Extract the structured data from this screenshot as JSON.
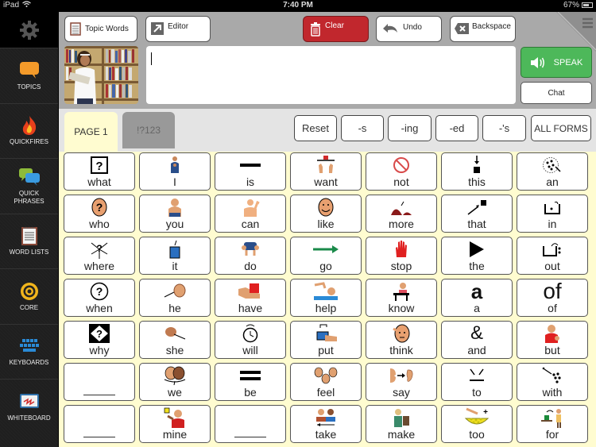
{
  "status_bar": {
    "device": "iPad",
    "time": "7:40 PM",
    "battery": "67%"
  },
  "sidebar": {
    "settings_icon": "gear-icon",
    "items": [
      {
        "label": "TOPICS",
        "icon": "speech-bubble-icon"
      },
      {
        "label": "QUICKFIRES",
        "icon": "flame-icon"
      },
      {
        "label": "QUICK\nPHRASES",
        "label_line1": "QUICK",
        "label_line2": "PHRASES",
        "icon": "chat-bubbles-icon"
      },
      {
        "label": "WORD LISTS",
        "icon": "notepad-icon"
      },
      {
        "label": "CORE",
        "icon": "target-icon"
      },
      {
        "label": "KEYBOARDS",
        "icon": "keyboard-icon"
      },
      {
        "label": "WHITEBOARD",
        "icon": "whiteboard-icon"
      }
    ]
  },
  "toolbar": {
    "topic_words": "Topic Words",
    "editor": "Editor",
    "clear": "Clear",
    "undo": "Undo",
    "backspace": "Backspace"
  },
  "message": {
    "value": ""
  },
  "speak": {
    "label": "SPEAK"
  },
  "chat": {
    "label": "Chat"
  },
  "tabs": [
    {
      "label": "PAGE 1",
      "active": true
    },
    {
      "label": "!?123",
      "active": false
    }
  ],
  "modifiers": [
    "Reset",
    "-s",
    "-ing",
    "-ed",
    "-'s",
    "ALL FORMS"
  ],
  "colors": {
    "clear": "#c1272d",
    "speak": "#4db85a",
    "grid_bg": "#fffcd0"
  },
  "grid": [
    [
      {
        "word": "what",
        "icon": "question-box"
      },
      {
        "word": "I",
        "icon": "person-self"
      },
      {
        "word": "is",
        "icon": "dash"
      },
      {
        "word": "want",
        "icon": "hands-reach"
      },
      {
        "word": "not",
        "icon": "prohibited"
      },
      {
        "word": "this",
        "icon": "arrow-down-square"
      },
      {
        "word": "an",
        "icon": "dots-circle"
      }
    ],
    [
      {
        "word": "who",
        "icon": "head-question"
      },
      {
        "word": "you",
        "icon": "person-pointing"
      },
      {
        "word": "can",
        "icon": "person-flex"
      },
      {
        "word": "like",
        "icon": "smiling-face"
      },
      {
        "word": "more",
        "icon": "pile-more"
      },
      {
        "word": "that",
        "icon": "arrow-square"
      },
      {
        "word": "in",
        "icon": "container-in"
      }
    ],
    [
      {
        "word": "where",
        "icon": "question-arrows"
      },
      {
        "word": "it",
        "icon": "blue-square"
      },
      {
        "word": "do",
        "icon": "person-doing"
      },
      {
        "word": "go",
        "icon": "green-arrow"
      },
      {
        "word": "stop",
        "icon": "red-hand"
      },
      {
        "word": "the",
        "icon": "play-triangle"
      },
      {
        "word": "out",
        "icon": "container-out"
      }
    ],
    [
      {
        "word": "when",
        "icon": "clock-question"
      },
      {
        "word": "he",
        "icon": "boy-head"
      },
      {
        "word": "have",
        "icon": "hand-red-box"
      },
      {
        "word": "help",
        "icon": "helping-hand"
      },
      {
        "word": "know",
        "icon": "person-desk"
      },
      {
        "word": "a",
        "icon": "letter-a"
      },
      {
        "word": "of",
        "icon": "word-of"
      }
    ],
    [
      {
        "word": "why",
        "icon": "diamond-question"
      },
      {
        "word": "she",
        "icon": "girl-head"
      },
      {
        "word": "will",
        "icon": "alarm-clock"
      },
      {
        "word": "put",
        "icon": "hand-place"
      },
      {
        "word": "think",
        "icon": "thinking-face"
      },
      {
        "word": "and",
        "icon": "ampersand"
      },
      {
        "word": "but",
        "icon": "person-but"
      }
    ],
    [
      {
        "word": "",
        "icon": "blank"
      },
      {
        "word": "we",
        "icon": "two-faces"
      },
      {
        "word": "be",
        "icon": "equals"
      },
      {
        "word": "feel",
        "icon": "three-faces"
      },
      {
        "word": "say",
        "icon": "mouth-ear"
      },
      {
        "word": "to",
        "icon": "arrows-to"
      },
      {
        "word": "with",
        "icon": "dots-with"
      }
    ],
    [
      {
        "word": "",
        "icon": "blank"
      },
      {
        "word": "mine",
        "icon": "person-mine"
      },
      {
        "word": "",
        "icon": "blank"
      },
      {
        "word": "take",
        "icon": "people-take"
      },
      {
        "word": "make",
        "icon": "person-make"
      },
      {
        "word": "too",
        "icon": "bowl-plus"
      },
      {
        "word": "for",
        "icon": "person-give"
      }
    ]
  ]
}
